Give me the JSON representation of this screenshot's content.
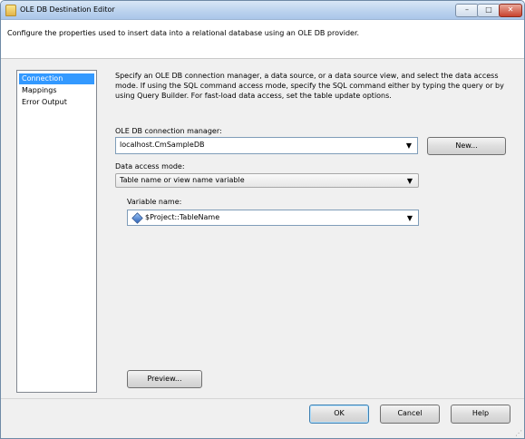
{
  "window": {
    "title": "OLE DB Destination Editor",
    "controls": {
      "minimize": "–",
      "maximize": "□",
      "close": "✕"
    }
  },
  "header": {
    "description": "Configure the properties used to insert data into a relational database using an OLE DB provider."
  },
  "nav": {
    "items": [
      {
        "label": "Connection Manager",
        "selected": true
      },
      {
        "label": "Mappings",
        "selected": false
      },
      {
        "label": "Error Output",
        "selected": false
      }
    ]
  },
  "main": {
    "description": "Specify an OLE DB connection manager, a data source, or a data source view, and select the data access mode. If using the SQL command access mode, specify the SQL command either by typing the query or by using Query Builder. For fast-load data access, set the table update options.",
    "connection_manager_label": "OLE DB connection manager:",
    "connection_manager_value": "localhost.CmSampleDB",
    "new_button": "New...",
    "data_access_mode_label": "Data access mode:",
    "data_access_mode_value": "Table name or view name variable",
    "variable_name_label": "Variable name:",
    "variable_name_value": "$Project::TableName",
    "preview_button": "Preview..."
  },
  "footer": {
    "ok": "OK",
    "cancel": "Cancel",
    "help": "Help"
  },
  "icons": {
    "dropdown": "▼",
    "title_icon": "ssis-component-icon",
    "variable_icon": "variable-diamond-icon"
  },
  "colors": {
    "selection": "#3399ff",
    "titlebar": "#bcd3ee"
  }
}
